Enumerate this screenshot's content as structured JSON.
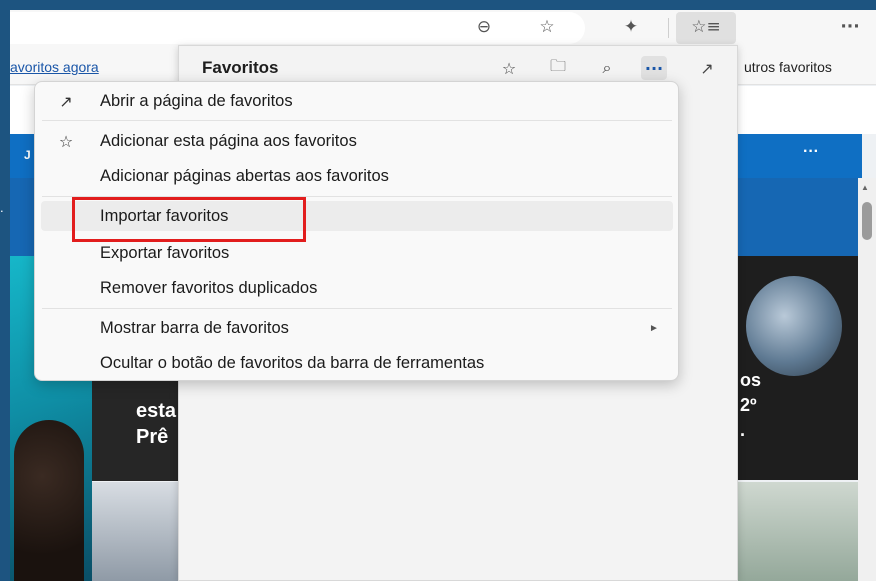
{
  "browser": {
    "toolbar": {
      "zoom_icon": "zoom-out-icon",
      "star_icon": "star-outline-icon",
      "extensions_icon": "puzzle-icon",
      "favorites_hub_icon": "favorites-list-icon",
      "more_label": "···"
    },
    "favorites_bar": {
      "left_link": "avoritos agora",
      "other_favorites": "utros favoritos"
    }
  },
  "page": {
    "nav_text": "J",
    "nav_more": "···",
    "left_edge_char": ".",
    "card_text_left": "esta\nPrê",
    "card_text_right": "os\n2º\n."
  },
  "hub": {
    "title": "Favoritos",
    "icons": [
      "add-favorite-icon",
      "add-folder-icon",
      "search-icon",
      "more-icon",
      "pin-icon"
    ],
    "more_label": "···"
  },
  "menu": {
    "items": [
      {
        "label": "Abrir a página de favoritos",
        "icon": "open-external-icon"
      },
      {
        "label": "Adicionar esta página aos favoritos",
        "icon": "add-favorite-icon"
      },
      {
        "label": "Adicionar páginas abertas aos favoritos",
        "icon": ""
      },
      {
        "label": "Importar favoritos",
        "icon": ""
      },
      {
        "label": "Exportar favoritos",
        "icon": ""
      },
      {
        "label": "Remover favoritos duplicados",
        "icon": ""
      },
      {
        "label": "Mostrar barra de favoritos",
        "icon": "",
        "submenu": "►"
      },
      {
        "label": "Ocultar o botão de favoritos da barra de ferramentas",
        "icon": ""
      }
    ],
    "highlight_color": "#e21d1d"
  }
}
